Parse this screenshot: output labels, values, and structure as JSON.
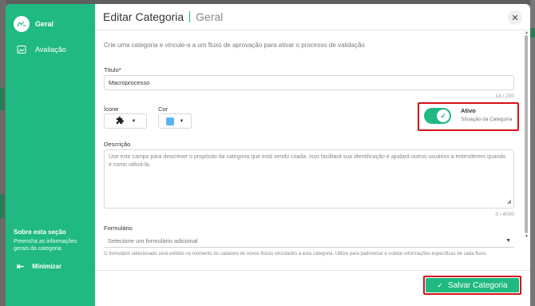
{
  "sidebar": {
    "items": [
      {
        "label": "Geral",
        "icon": "signature-icon"
      },
      {
        "label": "Avaliação",
        "icon": "image-frame-icon"
      }
    ],
    "section_title": "Sobre esta seção",
    "section_text": "Preencha as informações gerais da categoria.",
    "minimize_label": "Minimizar"
  },
  "header": {
    "title": "Editar Categoria",
    "subtitle": "Geral",
    "close_glyph": "✕"
  },
  "form": {
    "intro": "Crie uma categoria e vincule-a a um fluxo de aprovação para ativar o processo de validação",
    "title_label": "Título*",
    "title_value": "Macroprocesso",
    "title_counter": "13 / 200",
    "icon_label": "Ícone",
    "icon_value": "puzzle-icon",
    "color_label": "Cor",
    "color_value": "#5ab4f0",
    "status_label": "Ativo",
    "status_sub": "Situação da Categoria",
    "status_on": true,
    "description_label": "Descrição",
    "description_placeholder": "Use este campo para descrever o propósito da categoria que está sendo criada. Isso facilitará sua identificação e ajudará outros usuários a entenderem quando e como utilizá-la.",
    "description_counter": "0 / 4000",
    "form_label": "Formulário",
    "form_placeholder": "Selecione um formulário adicional",
    "form_help": "O formulário selecionado será exibido no momento do cadastro de novos fluxos vinculados a esta categoria. Utilize para padronizar e coletar informações específicas de cada fluxo."
  },
  "footer": {
    "save_label": "Salvar Categoria"
  },
  "colors": {
    "accent": "#1fb981",
    "highlight": "#d6101a"
  }
}
